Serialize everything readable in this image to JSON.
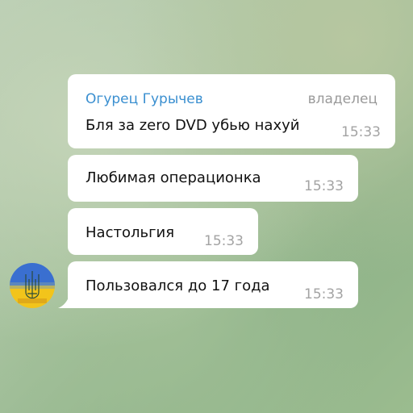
{
  "messages": [
    {
      "sender": "Огурец Гурычев",
      "role": "владелец",
      "text": "Бля за zero DVD убью нахуй",
      "time": "15:33"
    },
    {
      "text": "Любимая операционка",
      "time": "15:33"
    },
    {
      "text": "Настольгия",
      "time": "15:33"
    },
    {
      "text": "Пользовался до 17 года",
      "time": "15:33"
    }
  ],
  "colors": {
    "sender_name": "#3a8fd0",
    "bubble": "#ffffff",
    "timestamp": "#a3a3a3"
  },
  "avatar": {
    "description_icon": "ukraine-flag-trident-avatar"
  }
}
